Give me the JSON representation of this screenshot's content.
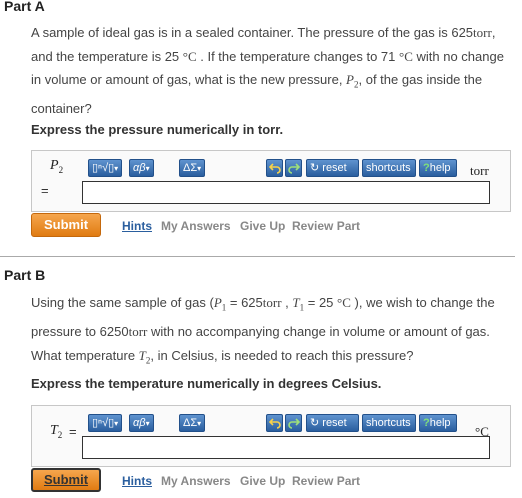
{
  "toolbar": {
    "templates": "▯ⁿ√▯",
    "greek": "αβ",
    "symbols": "ΔΣ",
    "reset": "reset",
    "shortcuts": "shortcuts",
    "help": "help",
    "help_mark": "?"
  },
  "actions": {
    "submit": "Submit",
    "hints": "Hints",
    "my_answers": "My Answers",
    "give_up": "Give Up",
    "review_part": "Review Part"
  },
  "partA": {
    "header": "Part A",
    "question": {
      "t1": "A sample of ideal gas is in a sealed container. The pressure of the gas is 625",
      "u1": "torr",
      "t2": ", and the temperature is 25 ",
      "deg": "°C",
      "t3": " . If the temperature changes to 71 ",
      "t4": " with no change in volume or amount of gas, what is the new pressure, ",
      "var": "P",
      "var_sub": "2",
      "t5": ", of the gas inside the container?"
    },
    "instruction": "Express the pressure numerically in torr.",
    "answer": {
      "var": "P",
      "var_sub": "2",
      "equals": "=",
      "value": "",
      "unit": "torr"
    }
  },
  "partB": {
    "header": "Part B",
    "question": {
      "t1": "Using the same sample of gas (",
      "p1": "P",
      "p1_sub": "1",
      "t2": " = 625",
      "u1": "torr",
      "t3": " , ",
      "tv1": "T",
      "tv1_sub": "1",
      "t4": " = 25 ",
      "deg": "°C",
      "t5": " ), we wish to change the pressure to 6250",
      "t6": " with no accompanying change in volume or amount of gas. What temperature ",
      "tv2": "T",
      "tv2_sub": "2",
      "t7": ", in Celsius, is needed to reach this pressure?"
    },
    "instruction": "Express the temperature numerically in degrees Celsius.",
    "answer": {
      "var": "T",
      "var_sub": "2",
      "equals": "=",
      "value": "",
      "unit": "°C"
    }
  }
}
